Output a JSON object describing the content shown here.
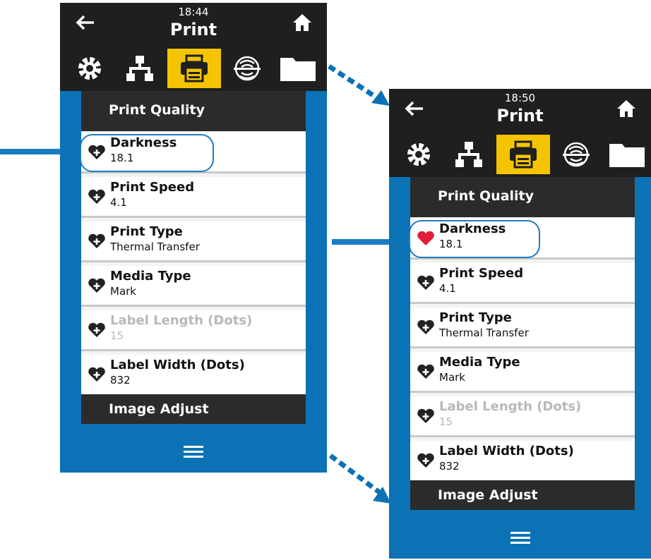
{
  "colors": {
    "brand_blue": "#0a72b5",
    "topbar": "#1f1f1f",
    "active_tab": "#f5c400",
    "selected_heart": "#e01e37"
  },
  "screens": [
    {
      "clock": "18:44",
      "title": "Print",
      "tabs": [
        {
          "icon": "gear-icon",
          "active": false
        },
        {
          "icon": "network-icon",
          "active": false
        },
        {
          "icon": "printer-icon",
          "active": true
        },
        {
          "icon": "wireless-icon",
          "active": false
        },
        {
          "icon": "folder-icon",
          "active": false
        }
      ],
      "section_top": "Print Quality",
      "items": [
        {
          "label": "Darkness",
          "value": "18.1",
          "favorite": false
        },
        {
          "label": "Print Speed",
          "value": "4.1",
          "favorite": false
        },
        {
          "label": "Print Type",
          "value": "Thermal Transfer",
          "favorite": false
        },
        {
          "label": "Media Type",
          "value": "Mark",
          "favorite": false
        },
        {
          "label": "Label Length (Dots)",
          "value": "15",
          "favorite": false,
          "disabled": true
        },
        {
          "label": "Label Width (Dots)",
          "value": "832",
          "favorite": false
        }
      ],
      "section_bottom": "Image Adjust"
    },
    {
      "clock": "18:50",
      "title": "Print",
      "tabs": [
        {
          "icon": "gear-icon",
          "active": false
        },
        {
          "icon": "network-icon",
          "active": false
        },
        {
          "icon": "printer-icon",
          "active": true
        },
        {
          "icon": "wireless-icon",
          "active": false
        },
        {
          "icon": "folder-icon",
          "active": false
        }
      ],
      "section_top": "Print Quality",
      "items": [
        {
          "label": "Darkness",
          "value": "18.1",
          "favorite": true
        },
        {
          "label": "Print Speed",
          "value": "4.1",
          "favorite": false
        },
        {
          "label": "Print Type",
          "value": "Thermal Transfer",
          "favorite": false
        },
        {
          "label": "Media Type",
          "value": "Mark",
          "favorite": false
        },
        {
          "label": "Label Length (Dots)",
          "value": "15",
          "favorite": false,
          "disabled": true
        },
        {
          "label": "Label Width (Dots)",
          "value": "832",
          "favorite": false
        }
      ],
      "section_bottom": "Image Adjust"
    }
  ]
}
